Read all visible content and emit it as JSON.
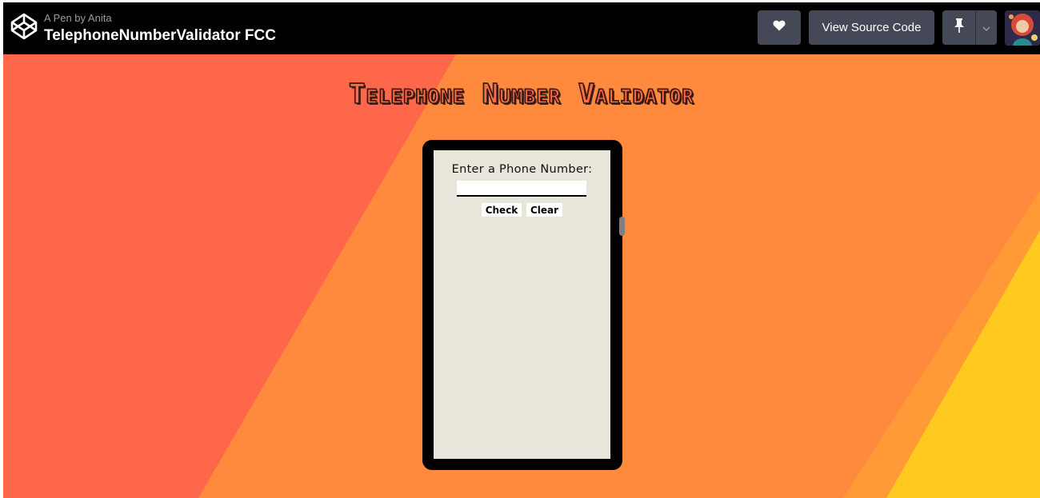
{
  "header": {
    "byline": "A Pen by Anita",
    "title": "TelephoneNumberValidator FCC",
    "view_source_label": "View Source Code",
    "icons": {
      "logo": "codepen-logo-icon",
      "like": "heart-icon",
      "pin": "pin-icon",
      "menu": "chevron-down-icon",
      "avatar": "user-avatar"
    }
  },
  "page": {
    "heading": "Telephone Number Validator",
    "phone": {
      "prompt": "Enter a Phone Number:",
      "input_value": "",
      "check_label": "Check",
      "clear_label": "Clear"
    }
  },
  "colors": {
    "header_bg": "#000000",
    "button_bg": "#444857",
    "stripe_red": "#ff674a",
    "stripe_orange": "#ff8a3d",
    "stripe_yellow": "#ffc91f",
    "phone_screen": "#e8e6da"
  }
}
